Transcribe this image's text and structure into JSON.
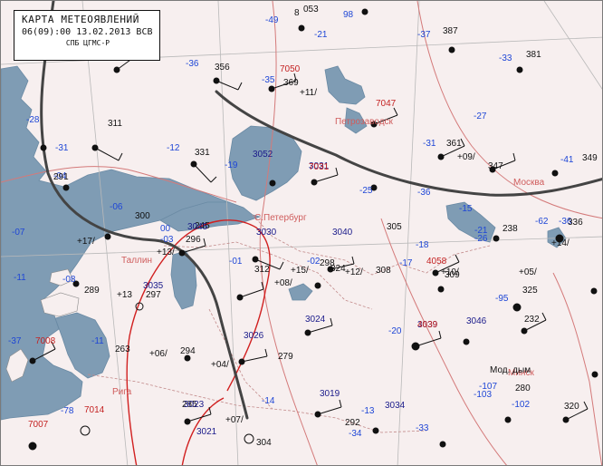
{
  "map_title": {
    "title": "КАРТА  МЕТЕОЯВЛЕНИЙ",
    "datetime": "06(09):00 13.02.2013 ВСВ",
    "source": "СПБ ЦГМС-Р"
  },
  "cities": [
    {
      "name": "Петрозаводск"
    },
    {
      "name": "С.Петербург"
    },
    {
      "name": "Таллин"
    },
    {
      "name": "Рига"
    },
    {
      "name": "Москва"
    },
    {
      "name": "Минск"
    }
  ],
  "colors": {
    "land": "#f7efef",
    "water": "#7f9cb4",
    "front_cold": "#444444",
    "isobar": "#d47a7a",
    "isotherm_zero": "#d12020",
    "grid": "#b9b9b9",
    "temperature_text": "#1e46d6",
    "pressure_tendency_text": "#c42222"
  },
  "station_labels": [
    "-49",
    "8",
    "053",
    "-21",
    "98",
    "-37",
    "-33",
    "-35",
    "-27",
    "-31",
    "-36",
    "7050",
    "-28",
    "-31",
    "-25",
    "-36",
    "-19",
    "-15",
    "-12",
    "-17",
    "-11",
    "-04",
    "-06",
    "00",
    "-03",
    "-07",
    "-01",
    "-02",
    "-08",
    "-11",
    "-37",
    "-78",
    "-13",
    "-18",
    "-20",
    "-62",
    "-21",
    "-26",
    "-41",
    "-36",
    "-95",
    "-14",
    "-33",
    "-34",
    "-107",
    "-103",
    "-102",
    "311",
    "331",
    "356",
    "369",
    "381",
    "387",
    "361",
    "347",
    "349",
    "291",
    "300",
    "289",
    "297",
    "285",
    "312",
    "324",
    "304",
    "294",
    "263",
    "325",
    "280",
    "238",
    "320",
    "296",
    "279",
    "232",
    "245",
    "292",
    "298",
    "336",
    "309",
    "308",
    "305",
    "3040",
    "3030",
    "3045",
    "3039",
    "3035",
    "3019",
    "3023",
    "3024",
    "3034",
    "3046",
    "3021",
    "3052",
    "3026",
    "3031",
    "7014",
    "7007",
    "7008",
    "7031",
    "7047",
    "4039",
    "4058",
    "+13/",
    "+10/",
    "+11/",
    "+15/",
    "+12/",
    "+09/",
    "+17/",
    "+13",
    "+07/",
    "+06/",
    "+08/",
    "+14/",
    "+05/",
    "+04/",
    "Мод. дым"
  ],
  "symbols": [
    {
      "kind": "cloud-cover-full",
      "count": 12
    },
    {
      "kind": "cloud-cover-half",
      "count": 10
    },
    {
      "kind": "snow-shower",
      "count": 8
    }
  ]
}
